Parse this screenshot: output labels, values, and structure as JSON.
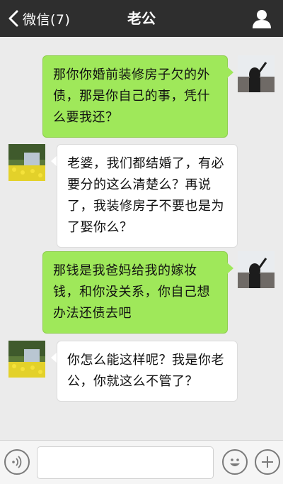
{
  "header": {
    "back_label": "微信(7)",
    "title": "老公"
  },
  "messages": [
    {
      "sender": "me",
      "text": "那你你婚前装修房子欠的外债，那是你自己的事，凭什么要我还？"
    },
    {
      "sender": "other",
      "text": "老婆，我们都结婚了，有必要分的这么清楚么？再说了，我装修房子不要也是为了娶你么？"
    },
    {
      "sender": "me",
      "text": "那钱是我爸妈给我的嫁妆钱，和你没关系，你自己想办法还债去吧"
    },
    {
      "sender": "other",
      "text": "你怎么能这样呢？我是你老公，你就这么不管了？"
    }
  ],
  "colors": {
    "header_bg": "#2e2e2e",
    "my_bubble": "#9fe85a",
    "their_bubble": "#ffffff",
    "chat_bg": "#ebebeb"
  }
}
